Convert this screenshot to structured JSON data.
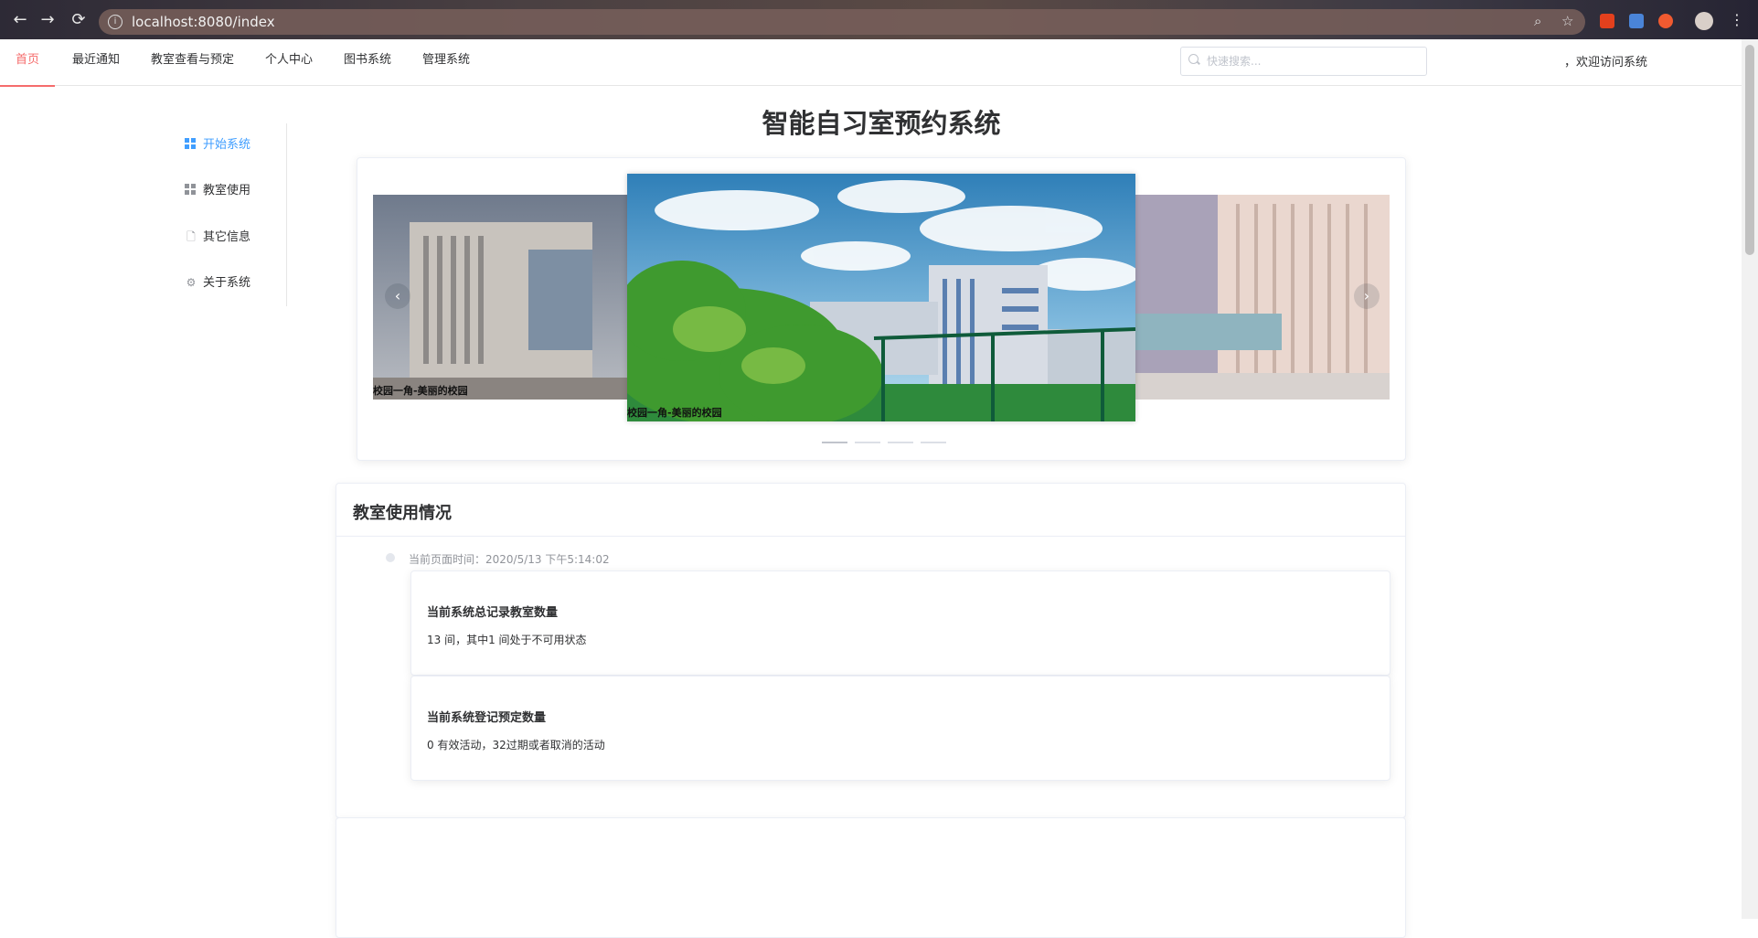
{
  "browser": {
    "url": "localhost:8080/index",
    "icons": [
      "back-arrow-icon",
      "forward-arrow-icon",
      "reload-icon",
      "info-icon",
      "zoom-icon",
      "star-icon",
      "office-icon",
      "translate-icon",
      "extension-icon",
      "profile-avatar",
      "menu-dots-icon"
    ]
  },
  "topnav": {
    "tabs": [
      {
        "label": "首页",
        "active": true
      },
      {
        "label": "最近通知"
      },
      {
        "label": "教室查看与预定"
      },
      {
        "label": "个人中心"
      },
      {
        "label": "图书系统"
      },
      {
        "label": "管理系统"
      }
    ],
    "search_placeholder": "快速搜索...",
    "welcome": "，欢迎访问系统"
  },
  "sidebar": {
    "items": [
      {
        "label": "开始系统",
        "icon": "grid-icon",
        "active": true
      },
      {
        "label": "教室使用",
        "icon": "grid-icon"
      },
      {
        "label": "其它信息",
        "icon": "document-icon"
      },
      {
        "label": "关于系统",
        "icon": "gear-icon"
      }
    ]
  },
  "main": {
    "title": "智能自习室预约系统",
    "carousel": {
      "captions": [
        "校园一角-美丽的校园",
        "校园一角-美丽的校园"
      ],
      "indicator_count": 4,
      "active_indicator": 0
    },
    "usage": {
      "title": "教室使用情况",
      "timestamp": "当前页面时间：2020/5/13 下午5:14:02",
      "stats": [
        {
          "title": "当前系统总记录教室数量",
          "value": "13 间，其中1 间处于不可用状态"
        },
        {
          "title": "当前系统登记预定数量",
          "value": "0 有效活动，32过期或者取消的活动"
        }
      ]
    }
  },
  "colors": {
    "active_tab": "#f56c6c",
    "active_side": "#409eff",
    "border": "#ebeef5"
  }
}
